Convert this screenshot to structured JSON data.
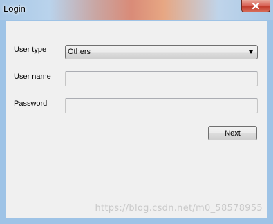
{
  "window": {
    "title": "Login"
  },
  "form": {
    "user_type_label": "User type",
    "user_type_value": "Others",
    "user_name_label": "User name",
    "user_name_value": "",
    "password_label": "Password",
    "password_value": "",
    "next_label": "Next"
  },
  "watermark": {
    "text": "https://blog.csdn.net/m0_58578955"
  },
  "colors": {
    "client_bg": "#f0f0f0",
    "close_red": "#c13b2b"
  },
  "icons": {
    "close": "close-icon",
    "dropdown": "chevron-down-icon"
  }
}
